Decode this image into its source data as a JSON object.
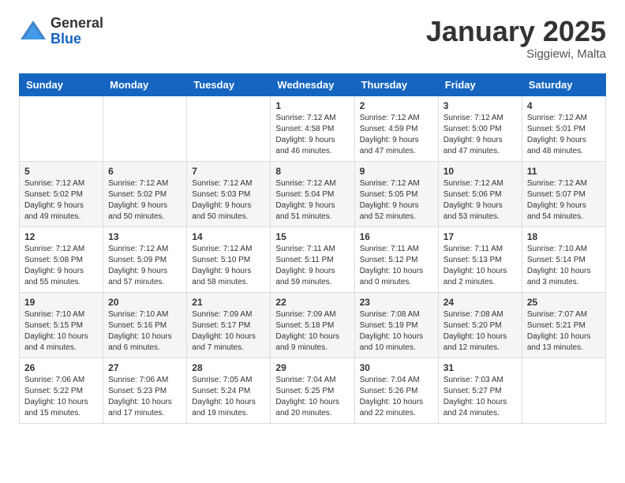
{
  "logo": {
    "general": "General",
    "blue": "Blue"
  },
  "header": {
    "month": "January 2025",
    "location": "Siggiewi, Malta"
  },
  "weekdays": [
    "Sunday",
    "Monday",
    "Tuesday",
    "Wednesday",
    "Thursday",
    "Friday",
    "Saturday"
  ],
  "weeks": [
    [
      {
        "day": "",
        "info": ""
      },
      {
        "day": "",
        "info": ""
      },
      {
        "day": "",
        "info": ""
      },
      {
        "day": "1",
        "info": "Sunrise: 7:12 AM\nSunset: 4:58 PM\nDaylight: 9 hours\nand 46 minutes."
      },
      {
        "day": "2",
        "info": "Sunrise: 7:12 AM\nSunset: 4:59 PM\nDaylight: 9 hours\nand 47 minutes."
      },
      {
        "day": "3",
        "info": "Sunrise: 7:12 AM\nSunset: 5:00 PM\nDaylight: 9 hours\nand 47 minutes."
      },
      {
        "day": "4",
        "info": "Sunrise: 7:12 AM\nSunset: 5:01 PM\nDaylight: 9 hours\nand 48 minutes."
      }
    ],
    [
      {
        "day": "5",
        "info": "Sunrise: 7:12 AM\nSunset: 5:02 PM\nDaylight: 9 hours\nand 49 minutes."
      },
      {
        "day": "6",
        "info": "Sunrise: 7:12 AM\nSunset: 5:02 PM\nDaylight: 9 hours\nand 50 minutes."
      },
      {
        "day": "7",
        "info": "Sunrise: 7:12 AM\nSunset: 5:03 PM\nDaylight: 9 hours\nand 50 minutes."
      },
      {
        "day": "8",
        "info": "Sunrise: 7:12 AM\nSunset: 5:04 PM\nDaylight: 9 hours\nand 51 minutes."
      },
      {
        "day": "9",
        "info": "Sunrise: 7:12 AM\nSunset: 5:05 PM\nDaylight: 9 hours\nand 52 minutes."
      },
      {
        "day": "10",
        "info": "Sunrise: 7:12 AM\nSunset: 5:06 PM\nDaylight: 9 hours\nand 53 minutes."
      },
      {
        "day": "11",
        "info": "Sunrise: 7:12 AM\nSunset: 5:07 PM\nDaylight: 9 hours\nand 54 minutes."
      }
    ],
    [
      {
        "day": "12",
        "info": "Sunrise: 7:12 AM\nSunset: 5:08 PM\nDaylight: 9 hours\nand 55 minutes."
      },
      {
        "day": "13",
        "info": "Sunrise: 7:12 AM\nSunset: 5:09 PM\nDaylight: 9 hours\nand 57 minutes."
      },
      {
        "day": "14",
        "info": "Sunrise: 7:12 AM\nSunset: 5:10 PM\nDaylight: 9 hours\nand 58 minutes."
      },
      {
        "day": "15",
        "info": "Sunrise: 7:11 AM\nSunset: 5:11 PM\nDaylight: 9 hours\nand 59 minutes."
      },
      {
        "day": "16",
        "info": "Sunrise: 7:11 AM\nSunset: 5:12 PM\nDaylight: 10 hours\nand 0 minutes."
      },
      {
        "day": "17",
        "info": "Sunrise: 7:11 AM\nSunset: 5:13 PM\nDaylight: 10 hours\nand 2 minutes."
      },
      {
        "day": "18",
        "info": "Sunrise: 7:10 AM\nSunset: 5:14 PM\nDaylight: 10 hours\nand 3 minutes."
      }
    ],
    [
      {
        "day": "19",
        "info": "Sunrise: 7:10 AM\nSunset: 5:15 PM\nDaylight: 10 hours\nand 4 minutes."
      },
      {
        "day": "20",
        "info": "Sunrise: 7:10 AM\nSunset: 5:16 PM\nDaylight: 10 hours\nand 6 minutes."
      },
      {
        "day": "21",
        "info": "Sunrise: 7:09 AM\nSunset: 5:17 PM\nDaylight: 10 hours\nand 7 minutes."
      },
      {
        "day": "22",
        "info": "Sunrise: 7:09 AM\nSunset: 5:18 PM\nDaylight: 10 hours\nand 9 minutes."
      },
      {
        "day": "23",
        "info": "Sunrise: 7:08 AM\nSunset: 5:19 PM\nDaylight: 10 hours\nand 10 minutes."
      },
      {
        "day": "24",
        "info": "Sunrise: 7:08 AM\nSunset: 5:20 PM\nDaylight: 10 hours\nand 12 minutes."
      },
      {
        "day": "25",
        "info": "Sunrise: 7:07 AM\nSunset: 5:21 PM\nDaylight: 10 hours\nand 13 minutes."
      }
    ],
    [
      {
        "day": "26",
        "info": "Sunrise: 7:06 AM\nSunset: 5:22 PM\nDaylight: 10 hours\nand 15 minutes."
      },
      {
        "day": "27",
        "info": "Sunrise: 7:06 AM\nSunset: 5:23 PM\nDaylight: 10 hours\nand 17 minutes."
      },
      {
        "day": "28",
        "info": "Sunrise: 7:05 AM\nSunset: 5:24 PM\nDaylight: 10 hours\nand 19 minutes."
      },
      {
        "day": "29",
        "info": "Sunrise: 7:04 AM\nSunset: 5:25 PM\nDaylight: 10 hours\nand 20 minutes."
      },
      {
        "day": "30",
        "info": "Sunrise: 7:04 AM\nSunset: 5:26 PM\nDaylight: 10 hours\nand 22 minutes."
      },
      {
        "day": "31",
        "info": "Sunrise: 7:03 AM\nSunset: 5:27 PM\nDaylight: 10 hours\nand 24 minutes."
      },
      {
        "day": "",
        "info": ""
      }
    ]
  ]
}
